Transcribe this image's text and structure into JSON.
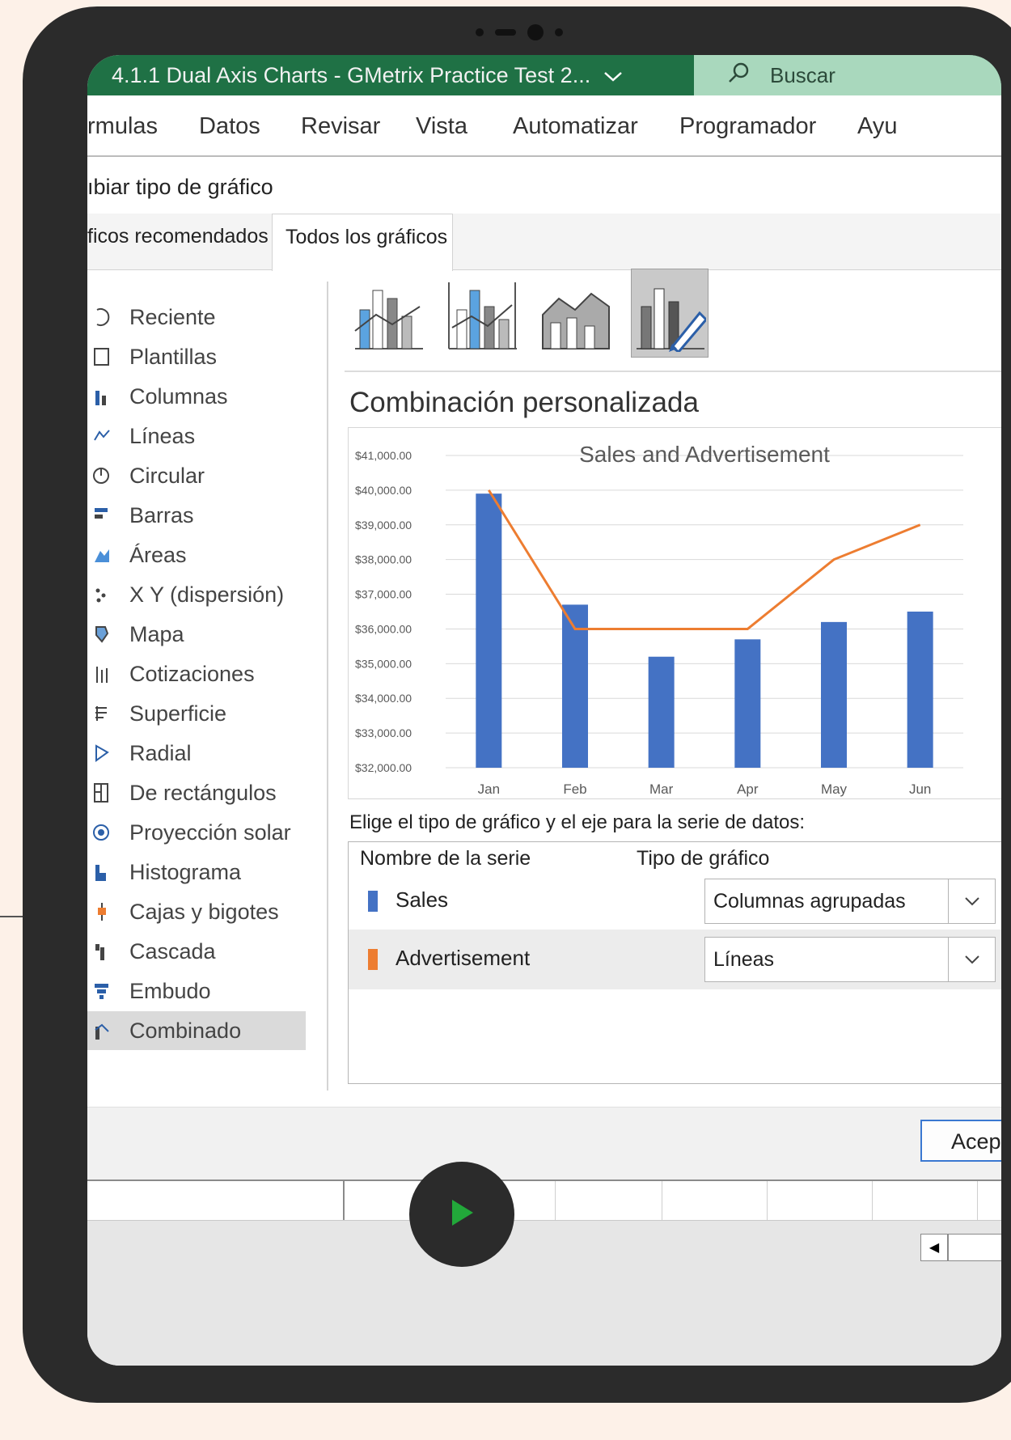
{
  "window": {
    "title": "4.1.1 Dual Axis Charts  -  GMetrix Practice Test 2...",
    "search_placeholder": "Buscar"
  },
  "ribbon": {
    "tabs": [
      "rmulas",
      "Datos",
      "Revisar",
      "Vista",
      "Automatizar",
      "Programador",
      "Ayu"
    ]
  },
  "dialog": {
    "title": "ıbiar tipo de gráfico",
    "tabs": [
      "ficos recomendados",
      "Todos los gráficos"
    ],
    "active_tab": "Todos los gráficos",
    "categories": [
      "Reciente",
      "Plantillas",
      "Columnas",
      "Líneas",
      "Circular",
      "Barras",
      "Áreas",
      "X Y (dispersión)",
      "Mapa",
      "Cotizaciones",
      "Superficie",
      "Radial",
      "De rectángulos",
      "Proyección solar",
      "Histograma",
      "Cajas y bigotes",
      "Cascada",
      "Embudo",
      "Combinado"
    ],
    "selected_category": "Combinado",
    "combo_subtype": "Combinación personalizada",
    "instructions": "Elige el tipo de gráfico y el eje para la serie de datos:",
    "table_headers": [
      "Nombre de la serie",
      "Tipo de gráfico"
    ],
    "series": [
      {
        "name": "Sales",
        "color": "#4472c4",
        "chart_type": "Columnas agrupadas"
      },
      {
        "name": "Advertisement",
        "color": "#ed7d31",
        "chart_type": "Líneas"
      }
    ],
    "ok_label": "Acep"
  },
  "chart_data": {
    "type": "bar",
    "title": "Sales and Advertisement",
    "categories": [
      "Jan",
      "Feb",
      "Mar",
      "Apr",
      "May",
      "Jun"
    ],
    "ylim": [
      32000,
      41000
    ],
    "y_ticks": [
      "$32,000.00",
      "$33,000.00",
      "$34,000.00",
      "$35,000.00",
      "$36,000.00",
      "$37,000.00",
      "$38,000.00",
      "$39,000.00",
      "$40,000.00",
      "$41,000.00"
    ],
    "series": [
      {
        "name": "Sales",
        "type": "bar",
        "color": "#4472c4",
        "values": [
          39900,
          36700,
          35200,
          35700,
          36200,
          36500
        ]
      },
      {
        "name": "Advertisement",
        "type": "line",
        "color": "#ed7d31",
        "values": [
          40000,
          36000,
          36000,
          36000,
          38000,
          39000
        ]
      }
    ],
    "secondary_axis_ticks": [
      "$",
      "$",
      "$",
      "$",
      "$",
      "$",
      "$",
      "$",
      "$",
      "$"
    ],
    "legend": "bottom"
  }
}
